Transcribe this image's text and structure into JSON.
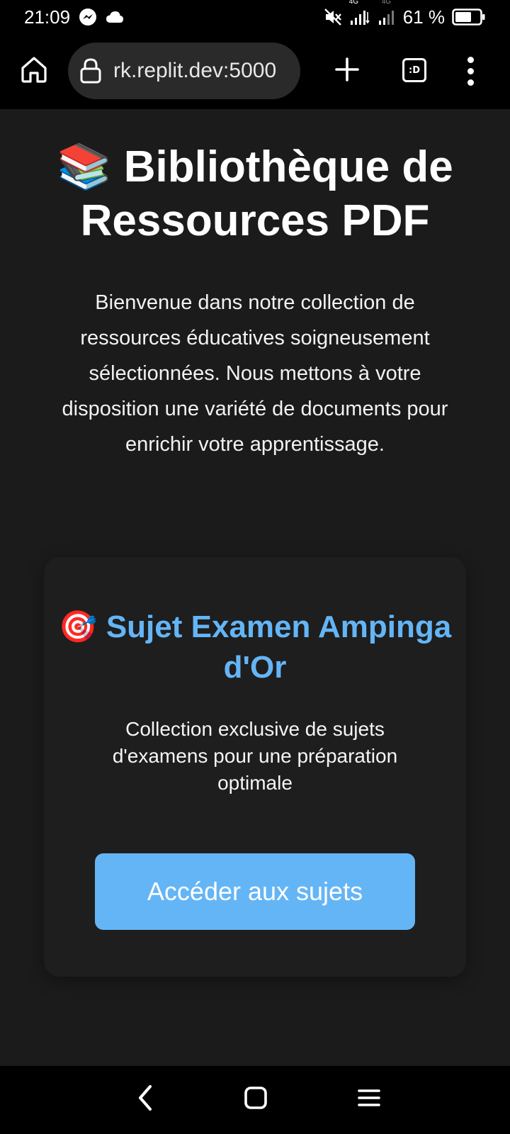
{
  "status_bar": {
    "time": "21:09",
    "network_label_1": "4G",
    "network_label_2": "4G",
    "battery": "61 %",
    "icons": [
      "messenger-icon",
      "cloud-icon",
      "mute-icon",
      "signal-icon",
      "signal-icon-2",
      "battery-icon"
    ]
  },
  "browser": {
    "url": "rk.replit.dev:5000",
    "tabs_label": ":D",
    "icons": [
      "home-icon",
      "lock-icon",
      "plus-icon",
      "tabs-icon",
      "more-vert-icon"
    ]
  },
  "page": {
    "title_emoji": "📚",
    "title": "Bibliothèque de Ressources PDF",
    "intro": "Bienvenue dans notre collection de ressources éducatives soigneusement sélectionnées. Nous mettons à votre disposition une variété de documents pour enrichir votre apprentissage."
  },
  "card": {
    "emoji": "🎯",
    "title": "Sujet Examen Ampinga d'Or",
    "description": "Collection exclusive de sujets d'examens pour une préparation optimale",
    "button_label": "Accéder aux sujets"
  },
  "colors": {
    "background": "#1b1b1b",
    "accent": "#64b5f6",
    "bar": "#000000"
  },
  "nav_bar": {
    "icons": [
      "back-icon",
      "home-square-icon",
      "recents-icon"
    ]
  }
}
